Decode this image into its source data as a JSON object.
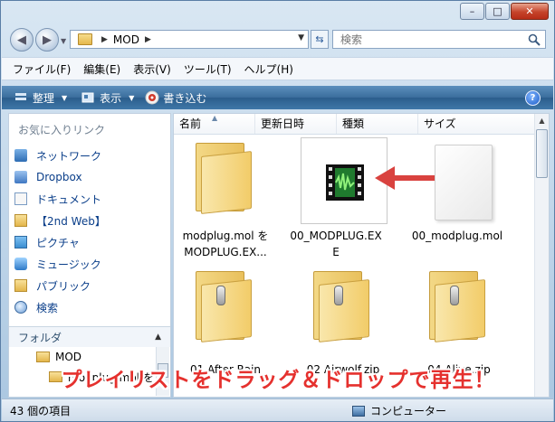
{
  "window": {
    "minimize": "–",
    "maximize": "□",
    "close": "✕"
  },
  "address": {
    "path": "MOD",
    "refresh_icon": "refresh-icon"
  },
  "search": {
    "placeholder": "検索"
  },
  "menu": [
    "ファイル(F)",
    "編集(E)",
    "表示(V)",
    "ツール(T)",
    "ヘルプ(H)"
  ],
  "commands": {
    "organize": "整理",
    "views": "表示",
    "burn": "書き込む",
    "help": "?"
  },
  "navigation": {
    "favorites_header": "お気に入りリンク",
    "favorites": [
      {
        "label": "ネットワーク",
        "icon": "network-icon"
      },
      {
        "label": "Dropbox",
        "icon": "dropbox-icon"
      },
      {
        "label": "ドキュメント",
        "icon": "documents-icon"
      },
      {
        "label": "【2nd Web】",
        "icon": "folder-icon"
      },
      {
        "label": "ピクチャ",
        "icon": "pictures-icon"
      },
      {
        "label": "ミュージック",
        "icon": "music-icon"
      },
      {
        "label": "パブリック",
        "icon": "folder-icon"
      },
      {
        "label": "検索",
        "icon": "search-icon"
      }
    ],
    "folders_header": "フォルダ",
    "tree": [
      {
        "label": "MOD"
      },
      {
        "label": "modplug.mol を"
      }
    ]
  },
  "columns": [
    "名前",
    "更新日時",
    "種類",
    "サイズ"
  ],
  "files": [
    {
      "name_line1": "modplug.mol を",
      "name_line2": "MODPLUG.EX...",
      "type": "folder"
    },
    {
      "name_line1": "00_MODPLUG.EX",
      "name_line2": "E",
      "type": "exe"
    },
    {
      "name_line1": "00_modplug.mol",
      "name_line2": "",
      "type": "file"
    },
    {
      "name_line1": "01 After Rain",
      "name_line2": "Music.zip",
      "type": "zip"
    },
    {
      "name_line1": "02 Airwolf.zip",
      "name_line2": "",
      "type": "zip"
    },
    {
      "name_line1": "04 Alive.zip",
      "name_line2": "",
      "type": "zip"
    }
  ],
  "annotation": "プレイリストをドラッグ＆ドロップで再生！",
  "status": {
    "count": "43 個の項目",
    "location": "コンピューター"
  },
  "colors": {
    "annotation_red": "#e5312e",
    "arrow_red": "#d9423f",
    "command_bar": "#3a6d9c"
  }
}
